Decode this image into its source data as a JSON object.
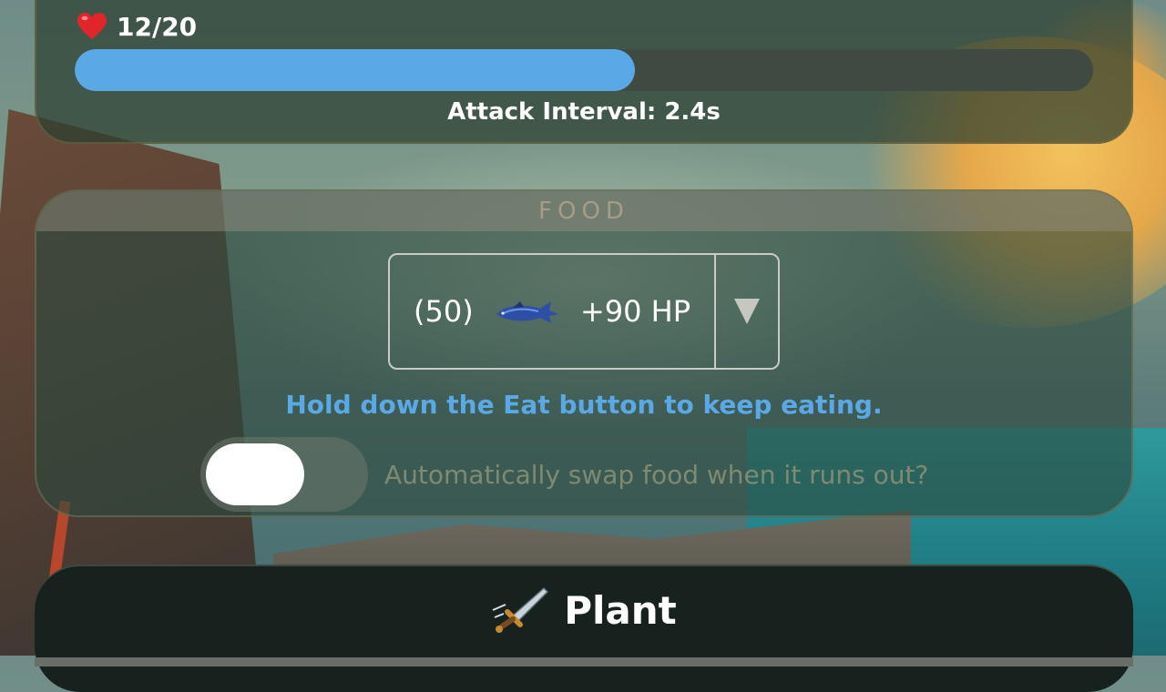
{
  "player": {
    "hp_label": "12/20",
    "hp_fraction": 0.55,
    "attack_interval_label": "Attack Interval: 2.4s",
    "hp_icon": "heart-icon"
  },
  "food": {
    "section_title": "FOOD",
    "selected": {
      "count_label": "(50)",
      "icon": "fish-icon",
      "heal_label": "+90 HP"
    },
    "hint": "Hold down the Eat button to keep eating.",
    "auto_swap_label": "Automatically swap food when it runs out?",
    "auto_swap_enabled": false
  },
  "plant": {
    "title": "Plant",
    "icon": "sword-icon"
  },
  "colors": {
    "hp_fill": "#5aa8e6",
    "hint": "#5aa8e6"
  }
}
